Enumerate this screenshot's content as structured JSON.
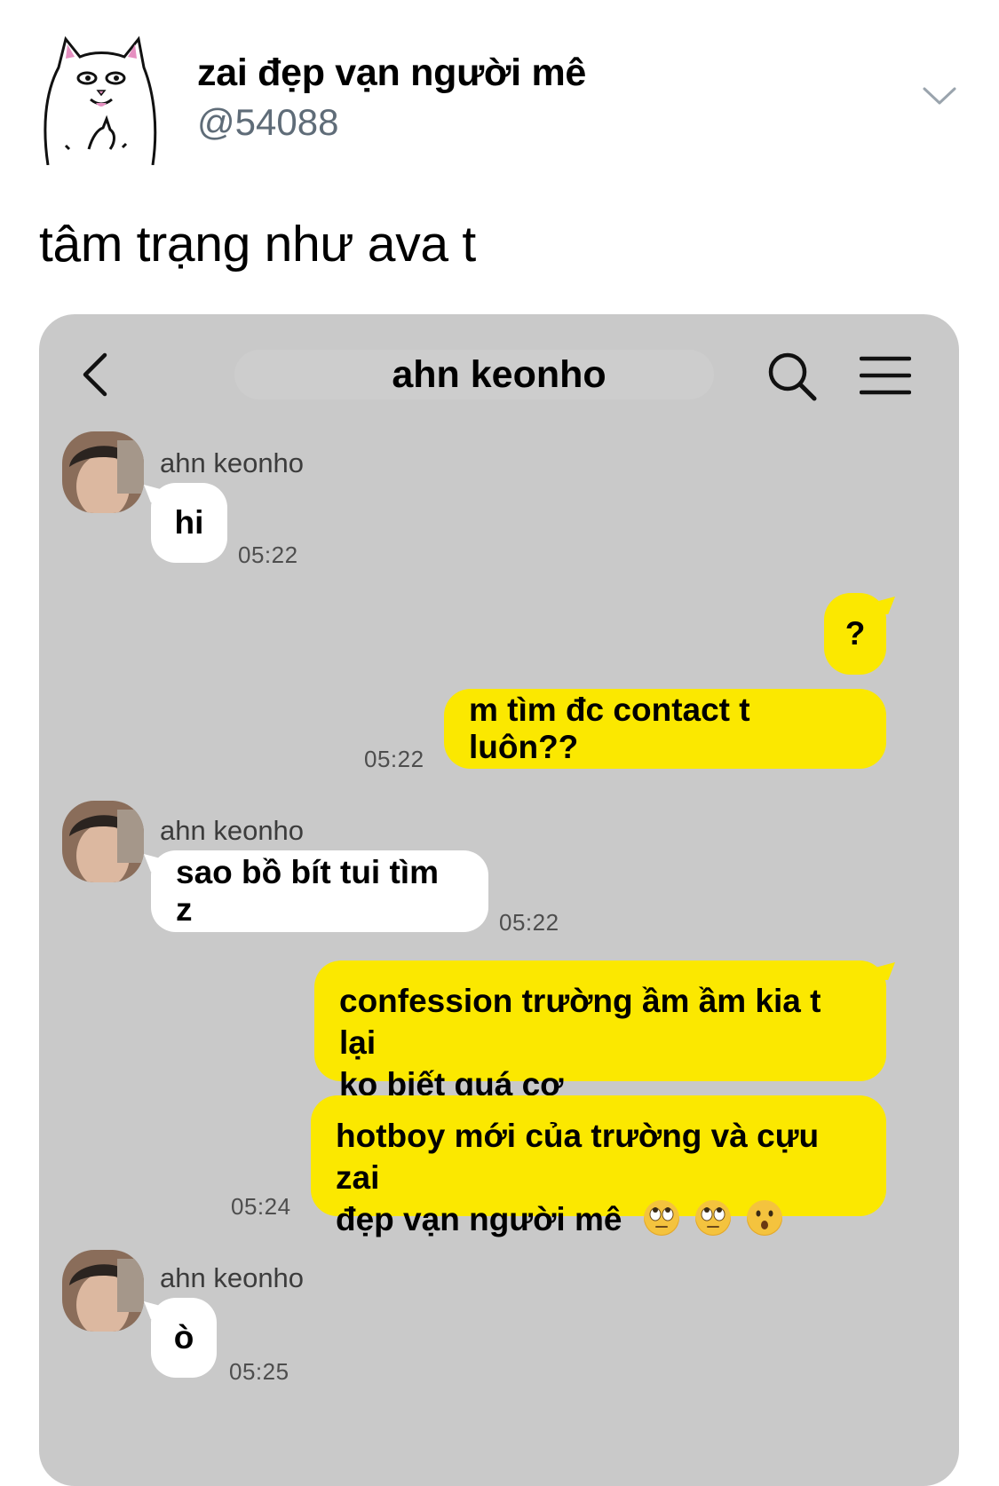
{
  "tweet": {
    "display_name": "zai đẹp vạn người mê",
    "handle": "@54088",
    "text": "tâm trạng như ava t"
  },
  "chat": {
    "title": "ahn keonho",
    "messages": [
      {
        "id": "m1",
        "side": "in",
        "sender": "ahn keonho",
        "text": "hi",
        "time": "05:22"
      },
      {
        "id": "m2",
        "side": "out",
        "text": "?"
      },
      {
        "id": "m3",
        "side": "out",
        "text": "m tìm đc contact t luôn??",
        "time": "05:22"
      },
      {
        "id": "m4",
        "side": "in",
        "sender": "ahn keonho",
        "text": "sao bồ bít tui tìm z",
        "time": "05:22"
      },
      {
        "id": "m5",
        "side": "out",
        "lines": [
          "confession trường ầm ầm kia t lại",
          "ko biết quá cơ"
        ]
      },
      {
        "id": "m6",
        "side": "out",
        "lines": [
          "hotboy mới của trường và cựu zai",
          "đẹp vạn người mê"
        ],
        "emoji": [
          "eye-roll-emoji",
          "eye-roll-emoji",
          "hushed-emoji"
        ],
        "time": "05:24"
      },
      {
        "id": "m7",
        "side": "in",
        "sender": "ahn keonho",
        "text": "ò",
        "time": "05:25"
      }
    ]
  },
  "icons": {
    "avatar": "cat-middle-finger-avatar",
    "more": "chevron-down-icon",
    "back": "back-arrow-icon",
    "search": "search-icon",
    "menu": "hamburger-menu-icon"
  },
  "colors": {
    "outgoing_bubble": "#fbe800",
    "incoming_bubble": "#ffffff",
    "chat_background": "#c9c9c9",
    "handle_text": "#5f6c78"
  }
}
